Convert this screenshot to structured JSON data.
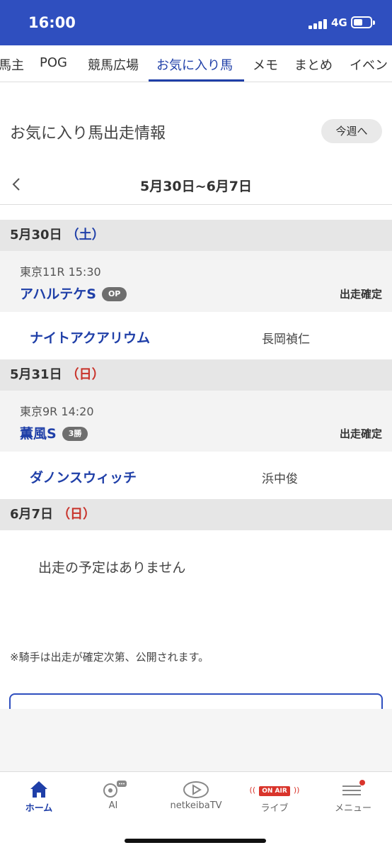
{
  "status": {
    "time": "16:00",
    "network": "4G"
  },
  "tabs": [
    "馬主",
    "POG",
    "競馬広場",
    "お気に入り馬",
    "メモ",
    "まとめ",
    "イベン"
  ],
  "active_tab": "お気に入り馬",
  "header": {
    "title": "お気に入り馬出走情報",
    "this_week_button": "今週へ"
  },
  "week": {
    "range": "5月30日~6月7日"
  },
  "days": [
    {
      "date": "5月30日",
      "dow": "（土）",
      "race": {
        "meta": "東京11R 15:30",
        "name": "アハルテケS",
        "grade": "OP",
        "status": "出走確定"
      },
      "horse": {
        "name": "ナイトアクアリウム",
        "jockey": "長岡禎仁"
      }
    },
    {
      "date": "5月31日",
      "dow": "（日）",
      "race": {
        "meta": "東京9R 14:20",
        "name": "薫風S",
        "grade": "3勝",
        "status": "出走確定"
      },
      "horse": {
        "name": "ダノンスウィッチ",
        "jockey": "浜中俊"
      }
    },
    {
      "date": "6月7日",
      "dow": "（日）"
    }
  ],
  "no_entry_text": "出走の予定はありません",
  "note": "※騎手は出走が確定次第、公開されます。",
  "bottom_nav": {
    "home": "ホーム",
    "ai": "AI",
    "tv": "netkeibaTV",
    "live": "ライブ",
    "live_badge": "ON AIR",
    "menu": "メニュー"
  },
  "colors": {
    "brand_blue": "#2f4fbf",
    "link_blue": "#1f3fa8",
    "sunday_red": "#c8322a",
    "onair_red": "#d9342b"
  },
  "icons": [
    "signal-icon",
    "battery-icon",
    "chevron-left-icon",
    "home-icon",
    "ai-icon",
    "play-icon",
    "broadcast-icon",
    "menu-icon"
  ]
}
